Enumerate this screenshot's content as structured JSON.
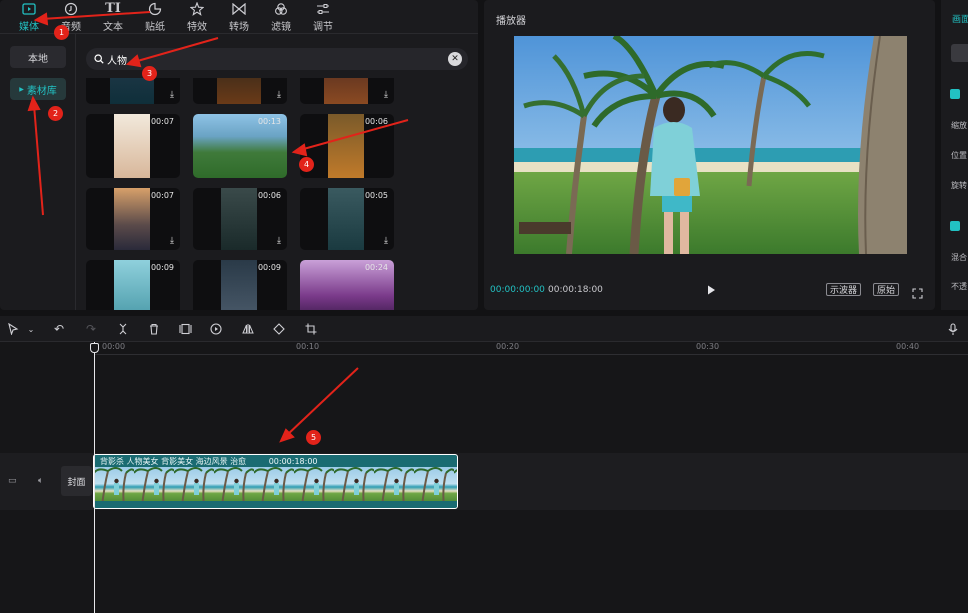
{
  "media_tabs": [
    {
      "label": "媒体",
      "icon": "media-icon",
      "active": true
    },
    {
      "label": "音频",
      "icon": "audio-icon",
      "active": false
    },
    {
      "label": "文本",
      "icon": "text-icon",
      "active": false
    },
    {
      "label": "贴纸",
      "icon": "sticker-icon",
      "active": false
    },
    {
      "label": "特效",
      "icon": "effects-icon",
      "active": false
    },
    {
      "label": "转场",
      "icon": "transition-icon",
      "active": false
    },
    {
      "label": "滤镜",
      "icon": "filter-icon",
      "active": false
    },
    {
      "label": "调节",
      "icon": "adjust-icon",
      "active": false
    }
  ],
  "sidebar": {
    "local_label": "本地",
    "library_label": "素材库"
  },
  "search": {
    "value": "人物"
  },
  "clips": [
    {
      "duration": ""
    },
    {
      "duration": ""
    },
    {
      "duration": ""
    },
    {
      "duration": "00:07"
    },
    {
      "duration": "00:13"
    },
    {
      "duration": "00:06"
    },
    {
      "duration": "00:07"
    },
    {
      "duration": "00:06"
    },
    {
      "duration": "00:05"
    },
    {
      "duration": "00:09"
    },
    {
      "duration": "00:09"
    },
    {
      "duration": "00:24"
    }
  ],
  "player": {
    "title": "播放器",
    "current_time": "00:00:00:00",
    "total_time": "00:00:18:00",
    "scope_label": "示波器",
    "ratio_label": "原始"
  },
  "props": {
    "title": "画面",
    "labels": [
      "缩放",
      "位置",
      "旋转",
      "混合",
      "不透"
    ]
  },
  "timeline": {
    "ticks": [
      "00:00",
      "00:10",
      "00:20",
      "00:30",
      "00:40"
    ],
    "cover_label": "封面",
    "clip_caption": "背影杀 人物美女 背影美女 海边风景 治愈",
    "clip_duration": "00:00:18:00"
  },
  "annotations": [
    "1",
    "2",
    "3",
    "4",
    "5"
  ],
  "colors": {
    "accent": "#22c1c3",
    "annotation": "#e2231a",
    "panel": "#1b1b1e",
    "background": "#121214"
  }
}
